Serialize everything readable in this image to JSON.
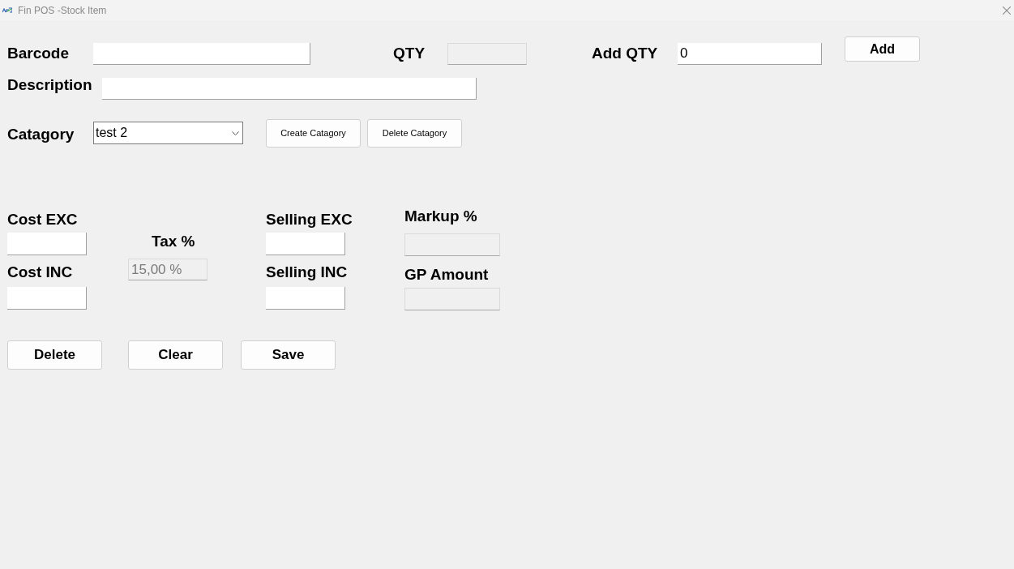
{
  "window": {
    "title": "Fin POS -Stock Item"
  },
  "barcode": {
    "label": "Barcode",
    "disabled": false
  },
  "qty": {
    "label": "QTY",
    "disabled": true
  },
  "add_qty": {
    "label": "Add QTY",
    "value": "0",
    "disabled": false
  },
  "add_button": "Add",
  "description": {
    "label": "Description",
    "disabled": false
  },
  "category": {
    "label": "Catagory",
    "value": "test 2"
  },
  "category_buttons": [
    "Create Catagory",
    "Delete Catagory"
  ],
  "pricing": {
    "cost_exc": {
      "label": "Cost EXC",
      "disabled": false
    },
    "cost_inc": {
      "label": "Cost INC",
      "disabled": false
    },
    "tax": {
      "label": "Tax %",
      "value": "15,00 %",
      "disabled": true
    },
    "selling_exc": {
      "label": "Selling EXC",
      "disabled": false
    },
    "selling_inc": {
      "label": "Selling INC",
      "disabled": false
    },
    "markup": {
      "label": "Markup %",
      "disabled": true
    },
    "gp_amount": {
      "label": "GP Amount",
      "disabled": true
    }
  },
  "action_buttons": [
    "Delete",
    "Clear",
    "Save"
  ]
}
